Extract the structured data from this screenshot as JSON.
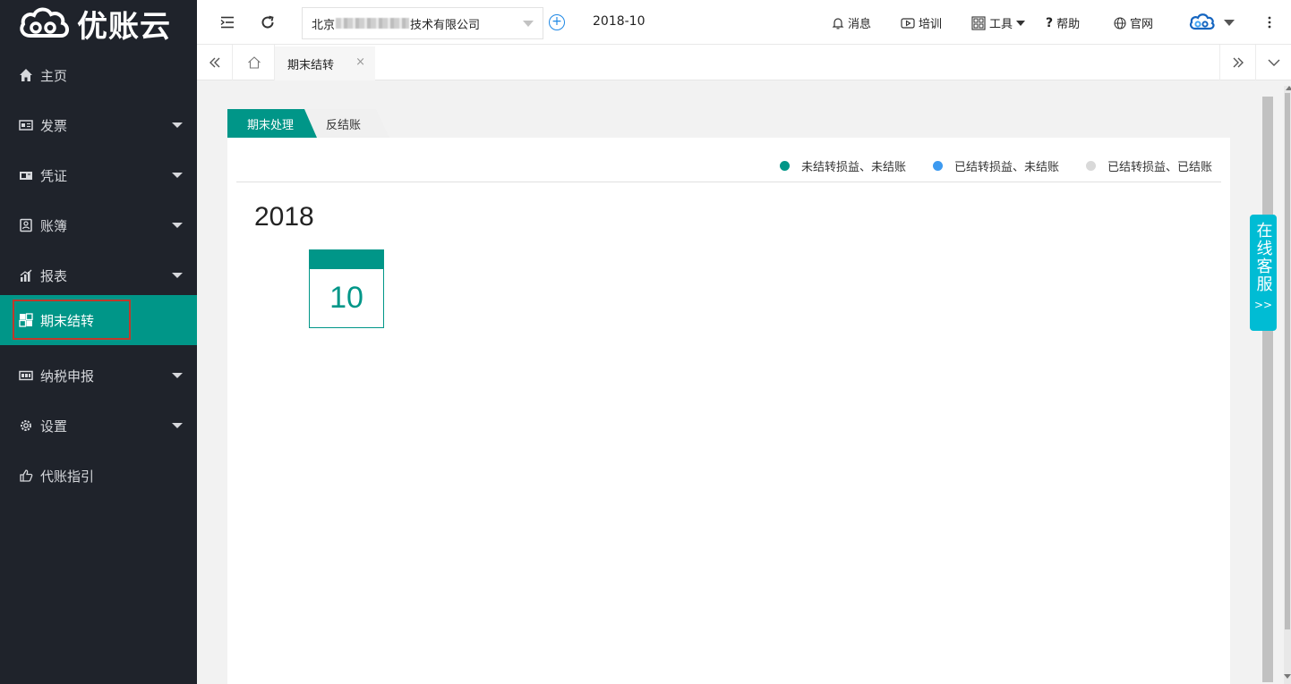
{
  "brand": {
    "name": "优账云"
  },
  "sidebar": {
    "items": [
      {
        "label": "主页",
        "icon": "home-icon",
        "has_caret": false
      },
      {
        "label": "发票",
        "icon": "invoice-icon",
        "has_caret": true
      },
      {
        "label": "凭证",
        "icon": "voucher-icon",
        "has_caret": true
      },
      {
        "label": "账簿",
        "icon": "ledger-icon",
        "has_caret": true
      },
      {
        "label": "报表",
        "icon": "chart-icon",
        "has_caret": true
      },
      {
        "label": "期末结转",
        "icon": "period-close-icon",
        "has_caret": false,
        "active": true
      },
      {
        "label": "纳税申报",
        "icon": "tax-icon",
        "has_caret": true
      },
      {
        "label": "设置",
        "icon": "gear-icon",
        "has_caret": true
      },
      {
        "label": "代账指引",
        "icon": "guide-icon",
        "has_caret": false
      }
    ],
    "active_color": "#009688",
    "bg_color": "#1f232b"
  },
  "topbar": {
    "company_prefix": "北京",
    "company_suffix": "技术有限公司",
    "period": "2018-10",
    "links": {
      "messages": "消息",
      "training": "培训",
      "tools": "工具",
      "help": "帮助",
      "website": "官网"
    }
  },
  "tabs": {
    "open_tab": "期末结转"
  },
  "main": {
    "subtabs": {
      "active": "期末处理",
      "other": "反结账"
    },
    "legend": [
      {
        "label": "未结转损益、未结账",
        "color": "#009688"
      },
      {
        "label": "已结转损益、未结账",
        "color": "#3d9af0"
      },
      {
        "label": "已结转损益、已结账",
        "color": "#d9d9d9"
      }
    ],
    "year": "2018",
    "month": "10"
  },
  "service": {
    "label": "在线客服",
    "arrow": ">>"
  }
}
